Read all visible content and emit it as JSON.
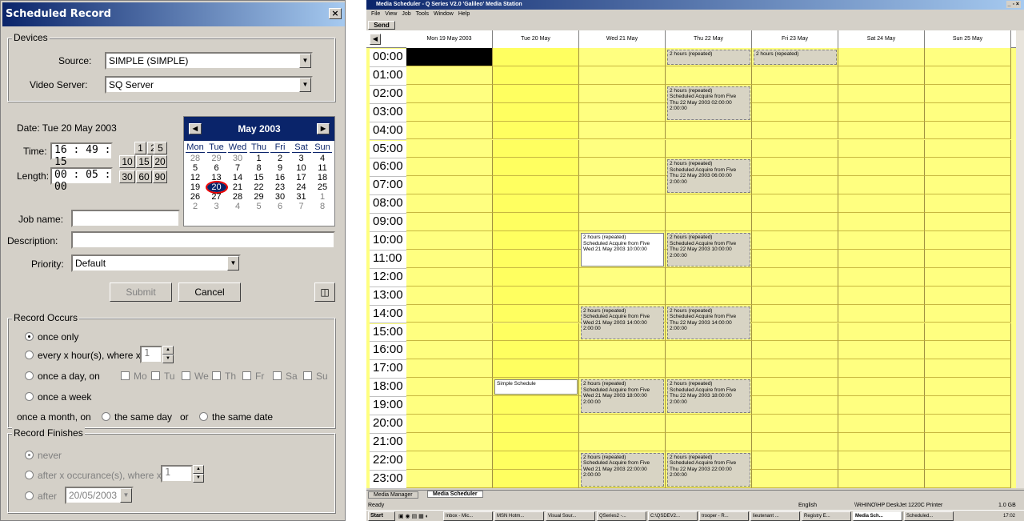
{
  "dialog": {
    "title": "Scheduled Record",
    "close": "×",
    "devices": {
      "label": "Devices",
      "source_label": "Source:",
      "source_value": "SIMPLE (SIMPLE)",
      "server_label": "Video Server:",
      "server_value": "SQ Server"
    },
    "date": "Date: Tue 20 May 2003",
    "time_label": "Time:",
    "time_value": "16 : 49 : 15",
    "length_label": "Length:",
    "length_value": "00 : 05 : 00",
    "quick_top": [
      "1",
      "2",
      "5"
    ],
    "quick_mid": [
      "10",
      "15",
      "20"
    ],
    "quick_bot": [
      "30",
      "60",
      "90"
    ],
    "calendar": {
      "month": "May 2003",
      "weekdays": [
        "Mon",
        "Tue",
        "Wed",
        "Thu",
        "Fri",
        "Sat",
        "Sun"
      ],
      "weeks": [
        [
          "28",
          "29",
          "30",
          "1",
          "2",
          "3",
          "4"
        ],
        [
          "5",
          "6",
          "7",
          "8",
          "9",
          "10",
          "11"
        ],
        [
          "12",
          "13",
          "14",
          "15",
          "16",
          "17",
          "18"
        ],
        [
          "19",
          "20",
          "21",
          "22",
          "23",
          "24",
          "25"
        ],
        [
          "26",
          "27",
          "28",
          "29",
          "30",
          "31",
          "1"
        ],
        [
          "2",
          "3",
          "4",
          "5",
          "6",
          "7",
          "8"
        ]
      ]
    },
    "job_name_label": "Job name:",
    "job_name_value": "",
    "description_label": "Description:",
    "description_value": "",
    "priority_label": "Priority:",
    "priority_value": "Default",
    "submit": "Submit",
    "cancel": "Cancel",
    "record_occurs": {
      "label": "Record Occurs",
      "once_only": "once only",
      "every_x": "every x hour(s), where x =",
      "every_x_value": "1",
      "once_a_day": "once a day, on",
      "days": [
        "Mo",
        "Tu",
        "We",
        "Th",
        "Fr",
        "Sa",
        "Su"
      ],
      "once_a_week": "once a week",
      "once_a_month": "once a month, on",
      "same_day": "the same day",
      "or": "or",
      "same_date": "the same date"
    },
    "record_finishes": {
      "label": "Record Finishes",
      "never": "never",
      "after_x": "after x occurance(s), where x =",
      "after_x_value": "1",
      "after": "after",
      "after_value": "20/05/2003"
    }
  },
  "scheduler": {
    "title": "Media Scheduler - Q Series V2.0 'Galileo' Media Station",
    "menu": [
      "File",
      "View",
      "Job",
      "Tools",
      "Window",
      "Help"
    ],
    "send": "Send",
    "days": [
      "Mon 19 May 2003",
      "Tue 20 May",
      "Wed 21 May",
      "Thu 22 May",
      "Fri 23 May",
      "Sat 24 May",
      "Sun 25 May"
    ],
    "hours": [
      "00:00",
      "01:00",
      "02:00",
      "03:00",
      "04:00",
      "05:00",
      "06:00",
      "07:00",
      "08:00",
      "09:00",
      "10:00",
      "11:00",
      "12:00",
      "13:00",
      "14:00",
      "15:00",
      "16:00",
      "17:00",
      "18:00",
      "19:00",
      "20:00",
      "21:00",
      "22:00",
      "23:00"
    ],
    "events": {
      "thu00": "2 hours (repeated)",
      "fri00": "2 hours (repeated)",
      "thu02": [
        "2 hours (repeated)",
        "Scheduled Acquire from Five",
        "Thu 22 May 2003  02:00:00",
        "2:00:00"
      ],
      "thu06": [
        "2 hours (repeated)",
        "Scheduled Acquire from Five",
        "Thu 22 May 2003  06:00:00",
        "2:00:00"
      ],
      "wed10": [
        "2 hours (repeated)",
        "Scheduled Acquire from Five",
        "Wed 21 May 2003  10:00:00"
      ],
      "thu10": [
        "2 hours (repeated)",
        "Scheduled Acquire from Five",
        "Thu 22 May 2003  10:00:00",
        "2:00:00"
      ],
      "wed14": [
        "2 hours (repeated)",
        "Scheduled Acquire from Five",
        "Wed 21 May 2003  14:00:00",
        "2:00:00"
      ],
      "thu14": [
        "2 hours (repeated)",
        "Scheduled Acquire from Five",
        "Thu 22 May 2003  14:00:00",
        "2:00:00"
      ],
      "tue18": "Simple Schedule",
      "wed18": [
        "2 hours (repeated)",
        "Scheduled Acquire from Five",
        "Wed 21 May 2003  18:00:00",
        "2:00:00"
      ],
      "thu18": [
        "2 hours (repeated)",
        "Scheduled Acquire from Five",
        "Thu 22 May 2003  18:00:00",
        "2:00:00"
      ],
      "wed22": [
        "2 hours (repeated)",
        "Scheduled Acquire from Five",
        "Wed 21 May 2003  22:00:00",
        "2:00:00"
      ],
      "thu22": [
        "2 hours (repeated)",
        "Scheduled Acquire from Five",
        "Thu 22 May 2003  22:00:00",
        "2:00:00"
      ]
    },
    "tabs": [
      "Media Manager",
      "Media Scheduler"
    ],
    "status": {
      "ready": "Ready",
      "lang": "English",
      "printer": "\\\\RHINO\\HP DeskJet 1220C Printer",
      "size": "1.0 GB"
    },
    "taskbar": {
      "start": "Start",
      "items": [
        "Inbox - Mic...",
        "MSN Hotm...",
        "Visual Sour...",
        "QSeries2 -...",
        "C:\\QSDEV2...",
        "trooper - R...",
        "lieutenant ...",
        "Registry E...",
        "Media Sch...",
        "Scheduled..."
      ],
      "clock": "17:02"
    },
    "colors": {
      "grid": "#ffff80",
      "today": "#ffff60",
      "selected": "#000000"
    }
  }
}
